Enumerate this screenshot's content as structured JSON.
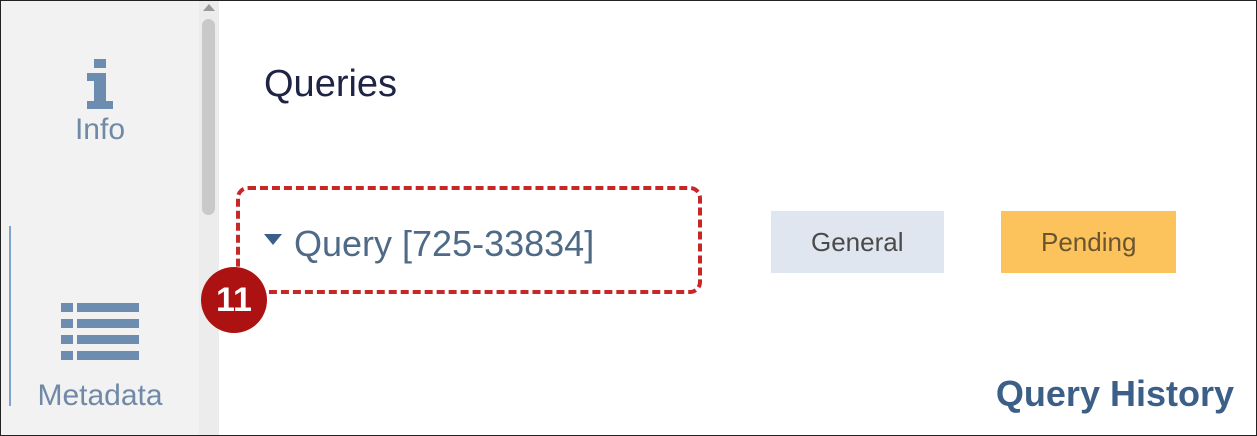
{
  "sidebar": {
    "items": [
      {
        "label": "Info",
        "icon": "info-icon"
      },
      {
        "label": "Metadata",
        "icon": "list-icon"
      }
    ]
  },
  "main": {
    "title": "Queries",
    "query": {
      "label": "Query [725-33834]",
      "expanded": true
    },
    "tags": [
      {
        "label": "General",
        "color": "#dfe6ef"
      },
      {
        "label": "Pending",
        "color": "#fcc35c"
      }
    ],
    "history_title": "Query History"
  },
  "annotation": {
    "number": "11",
    "color": "#c62828"
  }
}
